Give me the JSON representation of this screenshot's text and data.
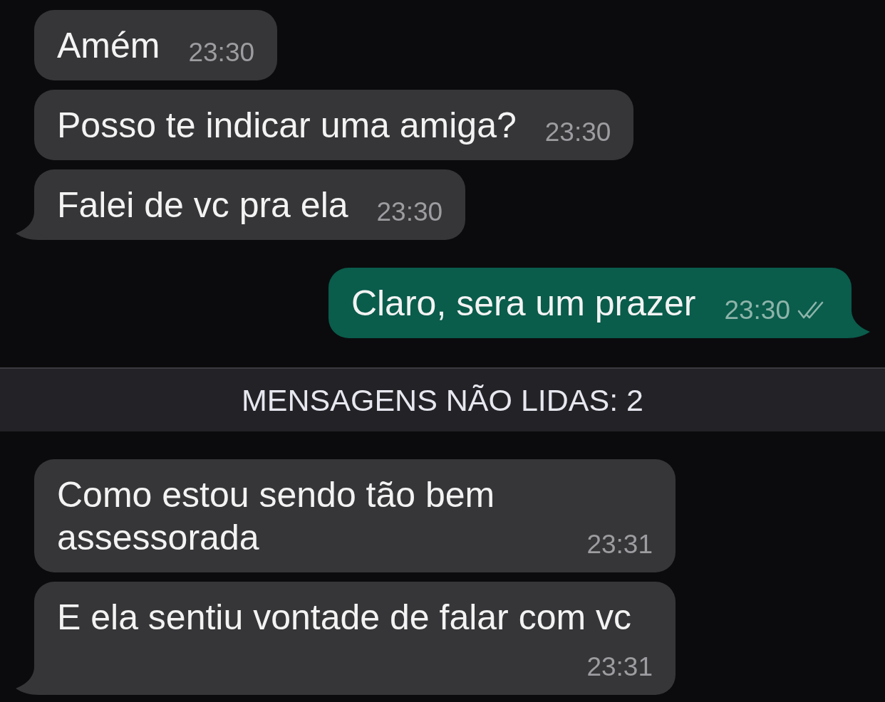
{
  "messages": [
    {
      "kind": "received",
      "text": "Amém",
      "time": "23:30"
    },
    {
      "kind": "received",
      "text": "Posso te indicar uma amiga?",
      "time": "23:30"
    },
    {
      "kind": "received",
      "text": "Falei de vc pra ela",
      "time": "23:30"
    },
    {
      "kind": "sent",
      "text": "Claro, sera um prazer",
      "time": "23:30",
      "delivered": true,
      "read": false
    },
    {
      "kind": "divider",
      "text": "MENSAGENS NÃO LIDAS: 2"
    },
    {
      "kind": "received",
      "text": "Como estou sendo tão bem assessorada",
      "time": "23:31"
    },
    {
      "kind": "received",
      "text": "E ela sentiu vontade de falar com vc",
      "time": "23:31"
    }
  ]
}
